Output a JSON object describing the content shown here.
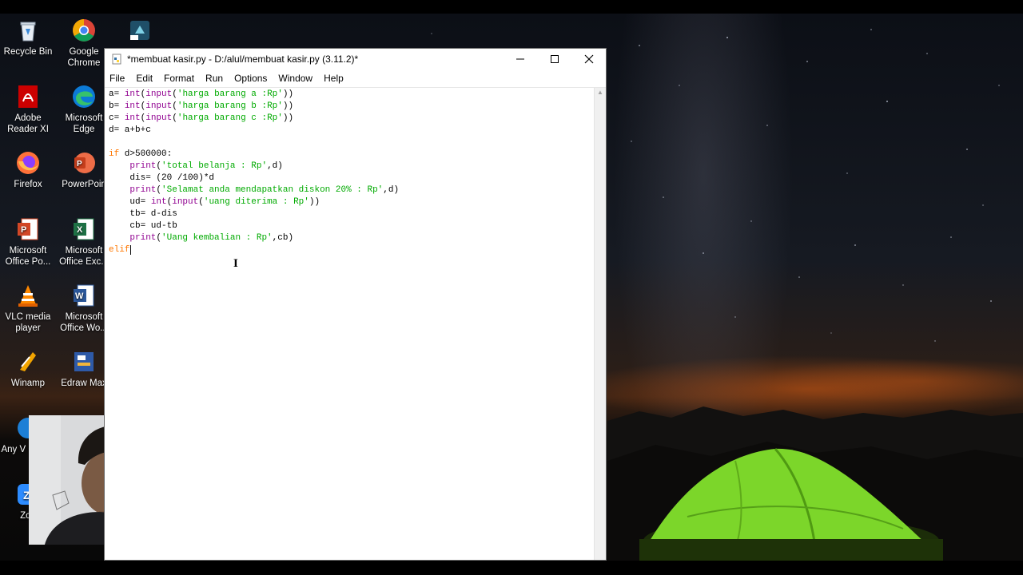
{
  "desktop_icons": [
    {
      "id": "recycle-bin",
      "label": "Recycle Bin",
      "icon": "recycle-bin-icon"
    },
    {
      "id": "google-chrome",
      "label": "Google Chrome",
      "icon": "chrome-icon"
    },
    {
      "id": "adobe-reader",
      "label": "Adobe Reader XI",
      "icon": "adobe-reader-icon"
    },
    {
      "id": "microsoft-edge",
      "label": "Microsoft Edge",
      "icon": "edge-icon"
    },
    {
      "id": "firefox",
      "label": "Firefox",
      "icon": "firefox-icon"
    },
    {
      "id": "powerpoint",
      "label": "PowerPoin",
      "icon": "powerpoint-icon"
    },
    {
      "id": "office-powerpoint",
      "label": "Microsoft Office Po...",
      "icon": "office-powerpoint-icon"
    },
    {
      "id": "office-excel",
      "label": "Microsoft Office Exc...",
      "icon": "excel-icon"
    },
    {
      "id": "vlc",
      "label": "VLC media player",
      "icon": "vlc-icon"
    },
    {
      "id": "office-word",
      "label": "Microsoft Office Wo...",
      "icon": "word-icon"
    },
    {
      "id": "winamp",
      "label": "Winamp",
      "icon": "winamp-icon"
    },
    {
      "id": "edraw-max",
      "label": "Edraw Max",
      "icon": "edraw-icon"
    },
    {
      "id": "any-video-converter",
      "label": "Any V Conve",
      "icon": "any-video-converter-icon"
    },
    {
      "id": "zoom",
      "label": "Zoo",
      "icon": "zoom-icon"
    },
    {
      "id": "shortcut",
      "label": "",
      "icon": "app-shortcut-icon"
    }
  ],
  "window": {
    "title": "*membuat kasir.py - D:/alul/membuat kasir.py (3.11.2)*",
    "controls": {
      "minimize": "—",
      "maximize": "☐",
      "close": "✕"
    },
    "menu": [
      "File",
      "Edit",
      "Format",
      "Run",
      "Options",
      "Window",
      "Help"
    ]
  },
  "code": [
    [
      [
        "",
        "a= "
      ],
      [
        "bi",
        "int"
      ],
      [
        "",
        "("
      ],
      [
        "bi",
        "input"
      ],
      [
        "",
        "("
      ],
      [
        "str",
        "'harga barang a :Rp'"
      ],
      [
        "",
        "))"
      ]
    ],
    [
      [
        "",
        "b= "
      ],
      [
        "bi",
        "int"
      ],
      [
        "",
        "("
      ],
      [
        "bi",
        "input"
      ],
      [
        "",
        "("
      ],
      [
        "str",
        "'harga barang b :Rp'"
      ],
      [
        "",
        "))"
      ]
    ],
    [
      [
        "",
        "c= "
      ],
      [
        "bi",
        "int"
      ],
      [
        "",
        "("
      ],
      [
        "bi",
        "input"
      ],
      [
        "",
        "("
      ],
      [
        "str",
        "'harga barang c :Rp'"
      ],
      [
        "",
        "))"
      ]
    ],
    [
      [
        "",
        "d= a+b+c"
      ]
    ],
    [
      [
        "",
        ""
      ]
    ],
    [
      [
        "kw",
        "if"
      ],
      [
        "",
        " d>500000:"
      ]
    ],
    [
      [
        "",
        "    "
      ],
      [
        "bi",
        "print"
      ],
      [
        "",
        "("
      ],
      [
        "str",
        "'total belanja : Rp'"
      ],
      [
        "",
        ",d)"
      ]
    ],
    [
      [
        "",
        "    dis= (20 /100)*d"
      ]
    ],
    [
      [
        "",
        "    "
      ],
      [
        "bi",
        "print"
      ],
      [
        "",
        "("
      ],
      [
        "str",
        "'Selamat anda mendapatkan diskon 20% : Rp'"
      ],
      [
        "",
        ",d)"
      ]
    ],
    [
      [
        "",
        "    ud= "
      ],
      [
        "bi",
        "int"
      ],
      [
        "",
        "("
      ],
      [
        "bi",
        "input"
      ],
      [
        "",
        "("
      ],
      [
        "str",
        "'uang diterima : Rp'"
      ],
      [
        "",
        "))"
      ]
    ],
    [
      [
        "",
        "    tb= d-dis"
      ]
    ],
    [
      [
        "",
        "    cb= ud-tb"
      ]
    ],
    [
      [
        "",
        "    "
      ],
      [
        "bi",
        "print"
      ],
      [
        "",
        "("
      ],
      [
        "str",
        "'Uang kembalian : Rp'"
      ],
      [
        "",
        ",cb)"
      ]
    ],
    [
      [
        "kw",
        "elif"
      ]
    ]
  ]
}
